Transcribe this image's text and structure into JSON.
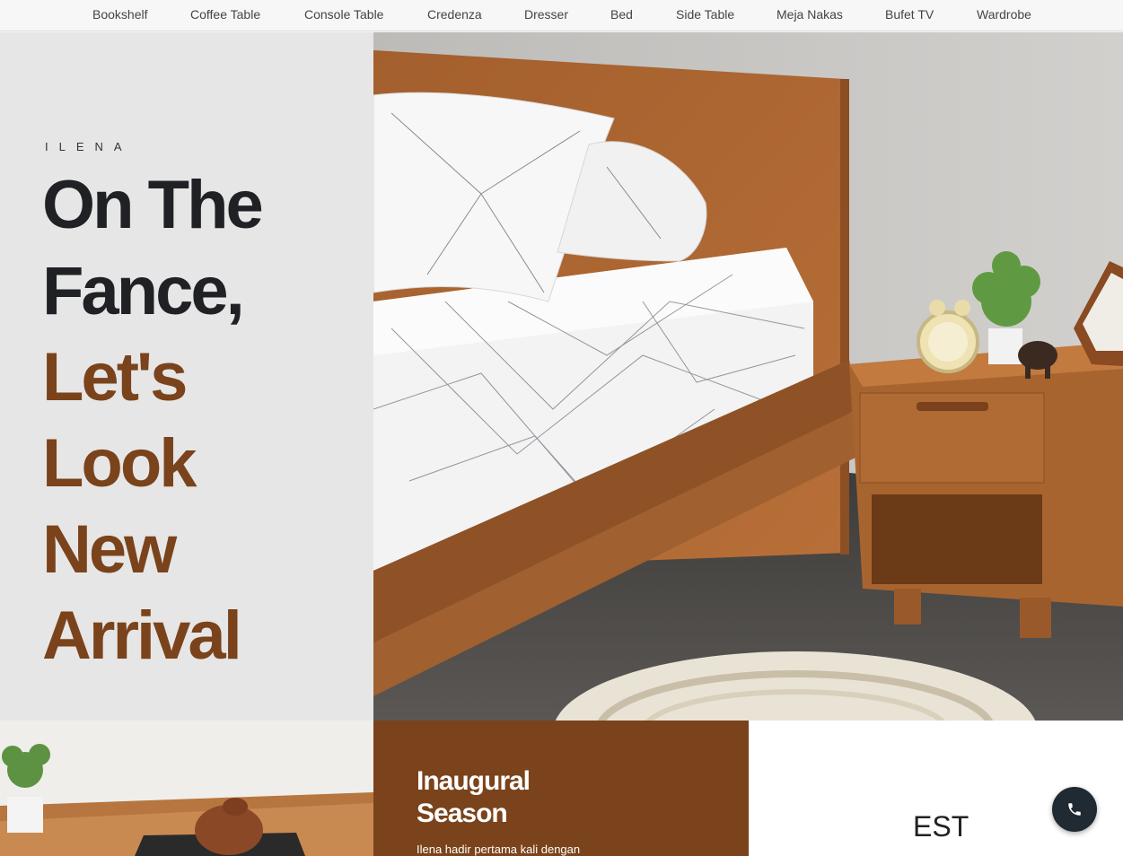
{
  "nav": {
    "items": [
      "Bookshelf",
      "Coffee Table",
      "Console Table",
      "Credenza",
      "Dresser",
      "Bed",
      "Side Table",
      "Meja Nakas",
      "Bufet TV",
      "Wardrobe"
    ]
  },
  "hero": {
    "brand": "ILENA",
    "headline_lines": [
      "On The",
      "Fance,",
      "Let's",
      "Look",
      "New",
      "Arrival"
    ],
    "image_icon": "bedroom-photo"
  },
  "promo": {
    "title_line1": "Inaugural",
    "title_line2": "Season",
    "text": "Ilena hadir pertama kali dengan"
  },
  "est": {
    "label": "EST"
  },
  "call_button": {
    "icon": "phone-icon"
  },
  "colors": {
    "accent_brown": "#7a431b",
    "dark_text": "#1f2125",
    "hero_left_bg": "#e6e6e6",
    "call_button_bg": "#1f2a33"
  }
}
